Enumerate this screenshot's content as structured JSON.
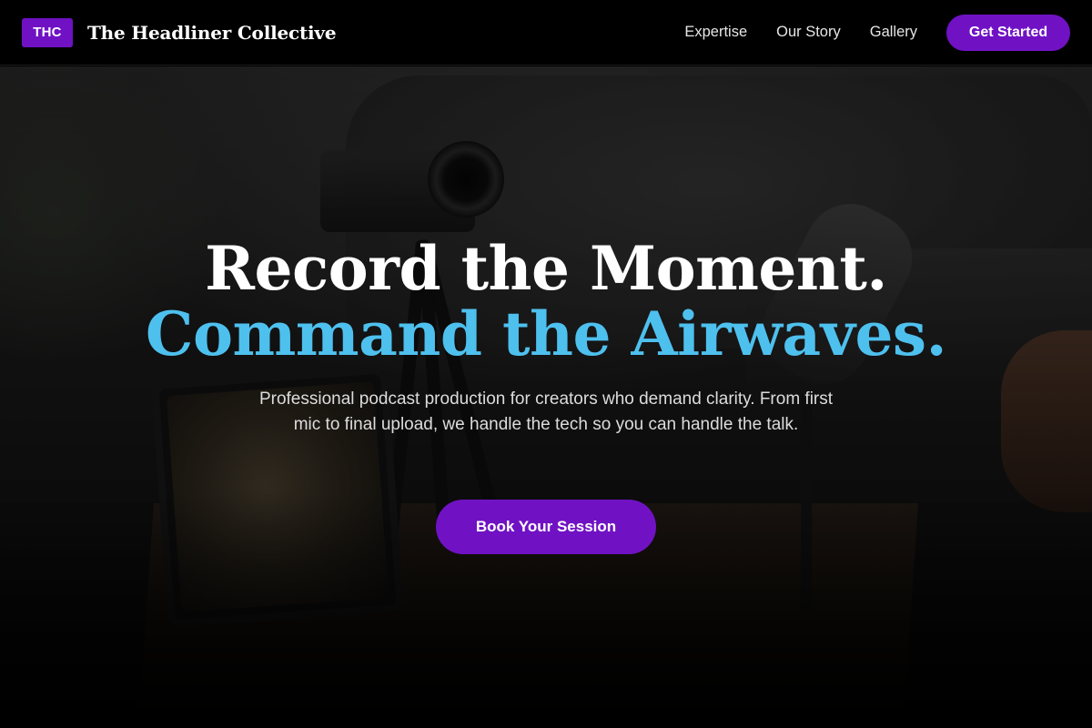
{
  "brand": {
    "badge": "THC",
    "name": "The Headliner Collective"
  },
  "nav": {
    "links": [
      {
        "label": "Expertise"
      },
      {
        "label": "Our Story"
      },
      {
        "label": "Gallery"
      }
    ],
    "cta_label": "Get Started"
  },
  "hero": {
    "headline_line1": "Record the Moment.",
    "headline_line2": "Command the Airwaves.",
    "subtext": "Professional podcast production for creators who demand clarity. From first mic to final upload, we handle the tech so you can handle the talk.",
    "cta_label": "Book Your Session"
  },
  "colors": {
    "accent": "#7012c4",
    "headline_highlight": "#4ec0ee",
    "background": "#000000"
  }
}
